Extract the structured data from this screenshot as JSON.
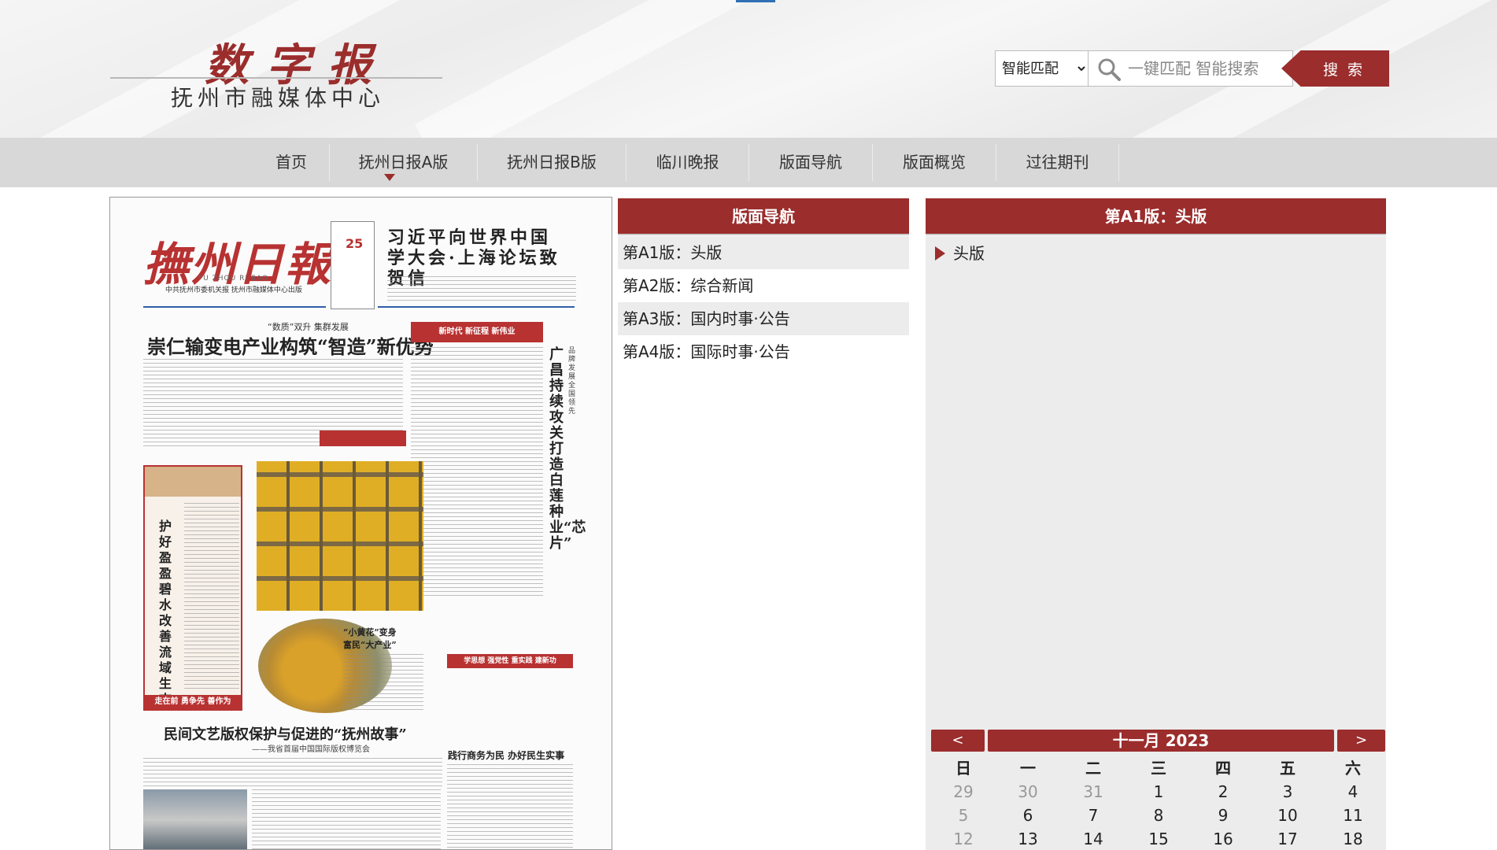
{
  "header": {
    "logo_title": "数字报",
    "logo_subtitle": "抚州市融媒体中心",
    "search": {
      "mode_options": [
        "智能匹配"
      ],
      "mode_selected": "智能匹配",
      "placeholder": "一键匹配 智能搜索",
      "button_label": "搜 索"
    }
  },
  "nav": {
    "items": [
      {
        "label": "首页"
      },
      {
        "label": "抚州日报A版",
        "active": true
      },
      {
        "label": "抚州日报B版"
      },
      {
        "label": "临川晚报"
      },
      {
        "label": "版面导航"
      },
      {
        "label": "版面概览"
      },
      {
        "label": "过往期刊"
      }
    ],
    "accent_color": "#9b2d2d"
  },
  "newspaper": {
    "masthead": "撫州日報",
    "masthead_pinyin": "FU ZHOU RI BAO",
    "org_line": "中共抚州市委机关报  抚州市融媒体中心出版",
    "date_day": "25",
    "headline_top": "习近平向世界中国学大会·上海论坛致贺信",
    "headline_main_kicker": "“数质”双升  集群发展",
    "headline_main": "崇仁输变电产业构筑“智造”新优势",
    "headline_vertical": "广昌持续攻关打造白莲种业“芯片”",
    "headline_vertical_small": "品牌发展全国领先",
    "banner_new_era": "新时代 新征程 新伟业",
    "left_box_vertical": "护好盈盈碧水 改善流域生态",
    "left_box_footer": "走在前 勇争先 善作为",
    "caption_flower": "“小黄花”变身富民“大产业”",
    "banner_study": "学思想 强党性 重实践 建新功",
    "headline_side": "践行商务为民 办好民生实事",
    "headline_bottom": "民间文艺版权保护与促进的“抚州故事”",
    "headline_bottom_sub": "——我省首届中国国际版权博览会"
  },
  "layout_nav": {
    "title": "版面导航",
    "items": [
      {
        "label": "第A1版：头版"
      },
      {
        "label": "第A2版：综合新闻"
      },
      {
        "label": "第A3版：国内时事·公告"
      },
      {
        "label": "第A4版：国际时事·公告"
      }
    ]
  },
  "page_panel": {
    "title": "第A1版：头版",
    "articles": [
      {
        "label": "头版"
      }
    ]
  },
  "calendar": {
    "prev_label": "<",
    "next_label": ">",
    "title": "十一月 2023",
    "weekdays": [
      "日",
      "一",
      "二",
      "三",
      "四",
      "五",
      "六"
    ],
    "weeks": [
      [
        {
          "d": "29",
          "o": true
        },
        {
          "d": "30",
          "o": true
        },
        {
          "d": "31",
          "o": true
        },
        {
          "d": "1"
        },
        {
          "d": "2"
        },
        {
          "d": "3"
        },
        {
          "d": "4"
        }
      ],
      [
        {
          "d": "5"
        },
        {
          "d": "6"
        },
        {
          "d": "7"
        },
        {
          "d": "8"
        },
        {
          "d": "9"
        },
        {
          "d": "10"
        },
        {
          "d": "11"
        }
      ],
      [
        {
          "d": "12"
        },
        {
          "d": "13"
        },
        {
          "d": "14"
        },
        {
          "d": "15"
        },
        {
          "d": "16"
        },
        {
          "d": "17"
        },
        {
          "d": "18"
        }
      ]
    ]
  }
}
